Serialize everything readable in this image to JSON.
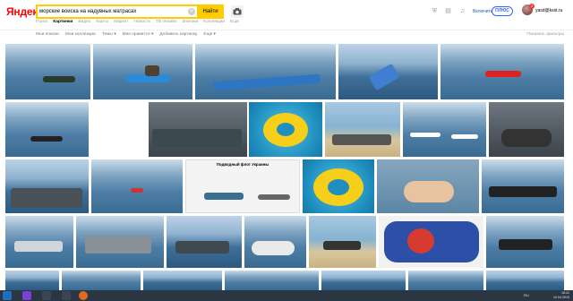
{
  "header": {
    "logo_text": "Яндекс",
    "search_value": "морские войска на надувных матрасах",
    "search_button": "Найти",
    "enable_link": "Включить",
    "plus_label": "ПЛЮС",
    "notifications": "2",
    "user_email": "yasd@ksst.ru"
  },
  "nav": [
    "Поиск",
    "Картинки",
    "Видео",
    "Карты",
    "Маркет",
    "Новости",
    "ТВ онлайн",
    "Знатоки",
    "Коллекции",
    "Ещё"
  ],
  "toolbar": {
    "items": [
      "Мои поиски",
      "Мои коллекции",
      "Темы ▾",
      "Мне нравится ▾",
      "Добавить картинку",
      "Ещё ▾"
    ],
    "report": "Показать фильтры"
  },
  "taskbar": {
    "lang": "RU",
    "time": "18:41",
    "date": "10.04.2019"
  },
  "colors": {
    "search_accent": "#ffcc00",
    "taskbar": "#2a3642",
    "link": "#1a5fb4"
  },
  "grid_title_text": "Подводный флот Украины"
}
